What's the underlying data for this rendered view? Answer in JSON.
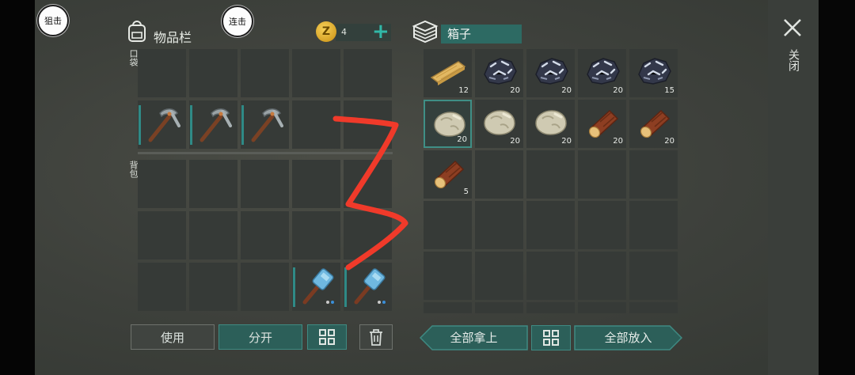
{
  "top_buttons": {
    "snipe": "狙击",
    "combo": "连击"
  },
  "inventory": {
    "title": "物品栏",
    "pocket_label": "口袋",
    "backpack_label": "背包"
  },
  "currency": {
    "icon": "gold-coin-icon",
    "amount": "4",
    "add": "+"
  },
  "storage": {
    "title": "箱子"
  },
  "inventory_slots": [
    {
      "item": ""
    },
    {
      "item": ""
    },
    {
      "item": ""
    },
    {
      "item": ""
    },
    {
      "item": ""
    },
    {
      "item": "pickaxe"
    },
    {
      "item": "pickaxe"
    },
    {
      "item": "pickaxe"
    },
    {
      "item": ""
    },
    {
      "item": ""
    },
    {
      "item": ""
    },
    {
      "item": ""
    },
    {
      "item": ""
    },
    {
      "item": ""
    },
    {
      "item": ""
    },
    {
      "item": ""
    },
    {
      "item": ""
    },
    {
      "item": ""
    },
    {
      "item": ""
    },
    {
      "item": ""
    },
    {
      "item": ""
    },
    {
      "item": ""
    },
    {
      "item": ""
    },
    {
      "item": "hammer"
    },
    {
      "item": "hammer"
    }
  ],
  "storage_slots": [
    {
      "item": "plank",
      "count": "12"
    },
    {
      "item": "ore",
      "count": "20"
    },
    {
      "item": "ore",
      "count": "20"
    },
    {
      "item": "ore",
      "count": "20"
    },
    {
      "item": "ore",
      "count": "15"
    },
    {
      "item": "stone",
      "count": "20"
    },
    {
      "item": "stone",
      "count": "20"
    },
    {
      "item": "stone",
      "count": "20"
    },
    {
      "item": "log",
      "count": "20"
    },
    {
      "item": "log",
      "count": "20"
    },
    {
      "item": "log",
      "count": "5"
    },
    {
      "item": "",
      "count": ""
    },
    {
      "item": "",
      "count": ""
    },
    {
      "item": "",
      "count": ""
    },
    {
      "item": "",
      "count": ""
    },
    {
      "item": "",
      "count": ""
    },
    {
      "item": "",
      "count": ""
    },
    {
      "item": "",
      "count": ""
    },
    {
      "item": "",
      "count": ""
    },
    {
      "item": "",
      "count": ""
    },
    {
      "item": "",
      "count": ""
    },
    {
      "item": "",
      "count": ""
    },
    {
      "item": "",
      "count": ""
    },
    {
      "item": "",
      "count": ""
    },
    {
      "item": "",
      "count": ""
    },
    {
      "item": "",
      "count": ""
    },
    {
      "item": "",
      "count": ""
    },
    {
      "item": "",
      "count": ""
    },
    {
      "item": "",
      "count": ""
    },
    {
      "item": "",
      "count": ""
    }
  ],
  "actions": {
    "use": "使用",
    "split": "分开",
    "take_all": "全部拿上",
    "put_all": "全部放入"
  },
  "close": {
    "label": "关闭"
  },
  "colors": {
    "accent": "#2c5f59",
    "scribble": "#f03a2a"
  }
}
